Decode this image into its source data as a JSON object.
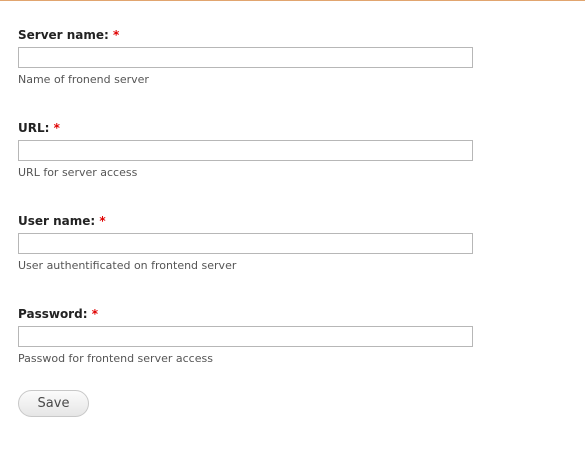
{
  "fields": [
    {
      "label": "Server name:",
      "required": "*",
      "value": "",
      "description": "Name of fronend server"
    },
    {
      "label": "URL:",
      "required": "*",
      "value": "",
      "description": "URL for server access"
    },
    {
      "label": "User name:",
      "required": "*",
      "value": "",
      "description": "User authentificated on frontend server"
    },
    {
      "label": "Password:",
      "required": "*",
      "value": "",
      "description": "Passwod for frontend server access"
    }
  ],
  "actions": {
    "save_label": "Save"
  }
}
